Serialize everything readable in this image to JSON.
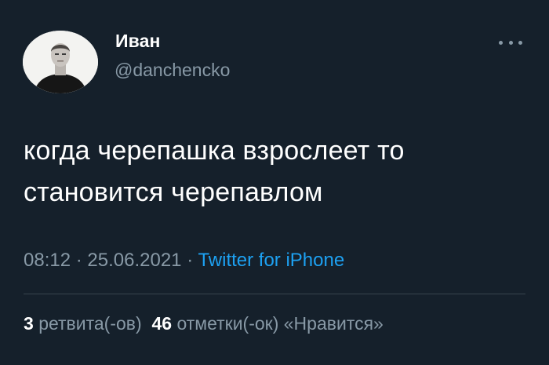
{
  "user": {
    "display_name": "Иван",
    "handle": "@danchencko"
  },
  "tweet": {
    "lines": [
      "когда черепашка взрослеет то",
      "становится черепавлом"
    ]
  },
  "meta": {
    "time": "08:12",
    "separator": "·",
    "date": "25.06.2021",
    "source": "Twitter for iPhone"
  },
  "stats": {
    "retweets_count": "3",
    "retweets_label": "ретвита(-ов)",
    "likes_count": "46",
    "likes_label": "отметки(-ок) «Нравится»"
  },
  "icons": {
    "more": "more-dots-icon",
    "avatar": "profile-photo"
  },
  "colors": {
    "background": "#15202b",
    "secondary_text": "#8899a6",
    "link": "#1da1f2",
    "divider": "#38444d"
  }
}
